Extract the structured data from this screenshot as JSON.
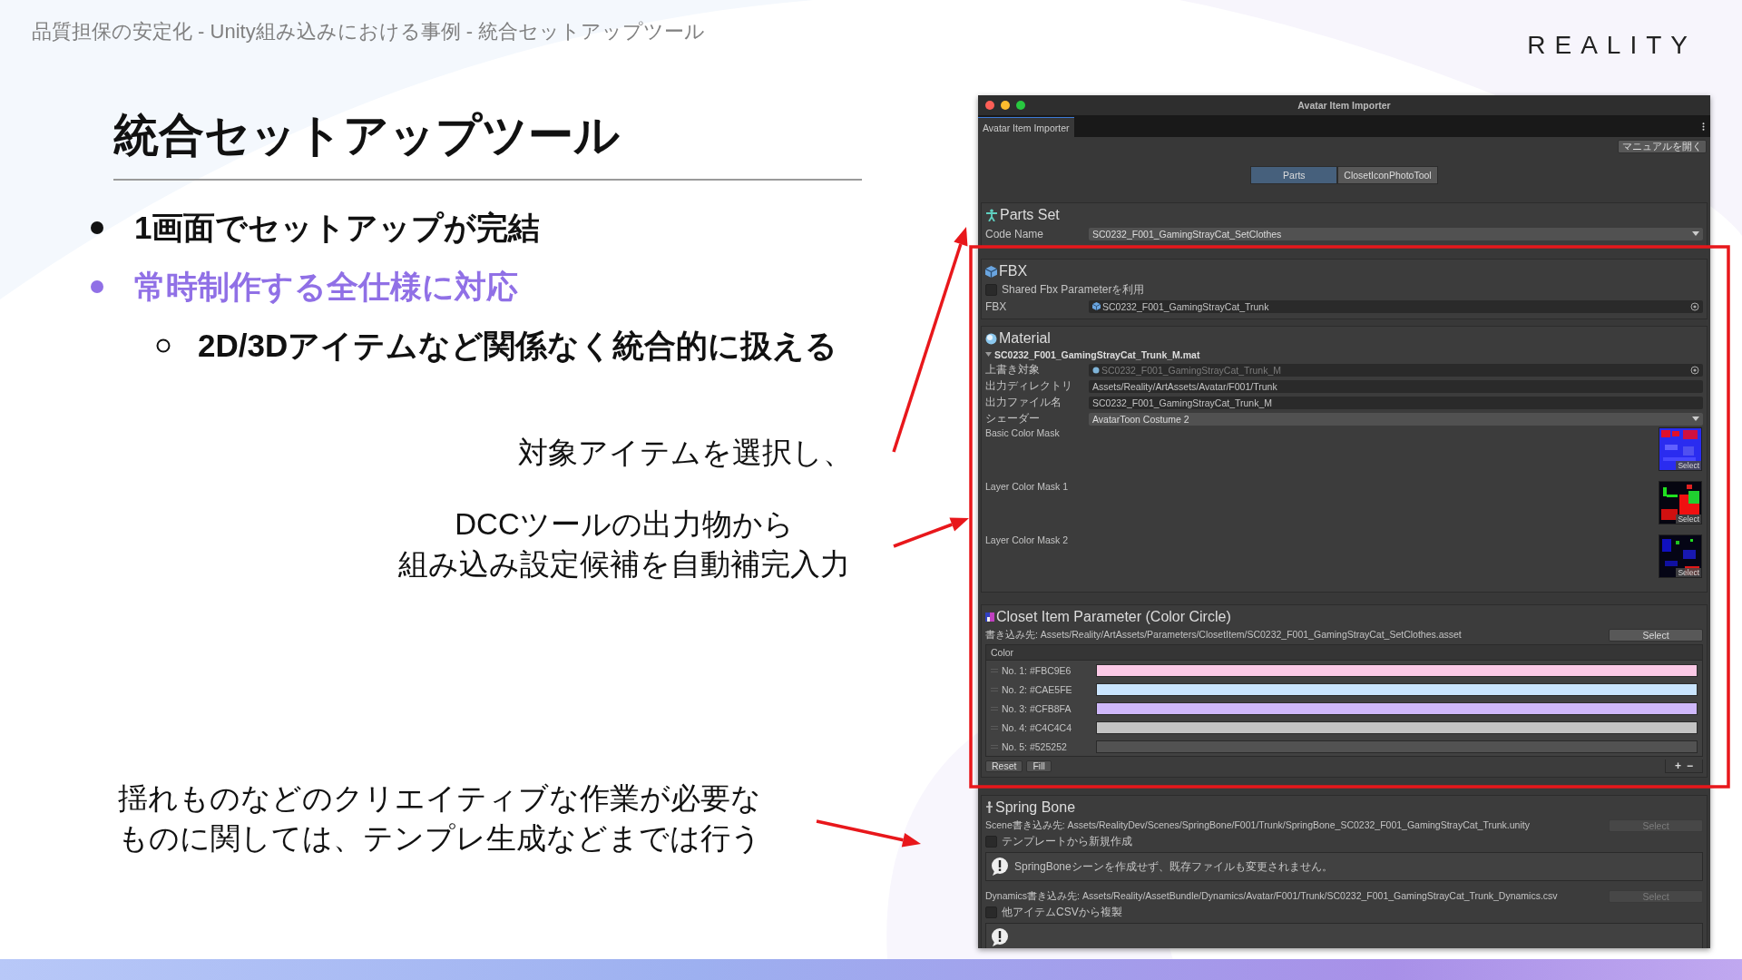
{
  "slide": {
    "breadcrumb": "品質担保の安定化 - Unity組み込みにおける事例 - 統合セットアップツール",
    "logo": "REALITY",
    "title": "統合セットアップツール",
    "bullets": [
      {
        "text": "1画面でセットアップが完結",
        "highlighted": false
      },
      {
        "text": "常時制作する全仕様に対応",
        "highlighted": true,
        "children": [
          {
            "text": "2D/3Dアイテムなど関係なく統合的に扱える"
          }
        ]
      }
    ],
    "callouts": [
      {
        "text": "対象アイテムを選択し、"
      },
      {
        "lines": [
          "DCCツールの出力物から",
          "組み込み設定候補を自動補完入力"
        ]
      },
      {
        "lines": [
          "揺れものなどのクリエイティブな作業が必要な",
          "ものに関しては、テンプレ生成などまでは行う"
        ]
      }
    ]
  },
  "window": {
    "title": "Avatar Item Importer",
    "tab": "Avatar Item Importer",
    "manual_button": "マニュアルを開く",
    "mode_tabs": [
      {
        "label": "Parts",
        "selected": true
      },
      {
        "label": "ClosetIconPhotoTool",
        "selected": false
      }
    ],
    "parts_set": {
      "title": "Parts Set",
      "label": "Code Name",
      "value": "SC0232_F001_GamingStrayCat_SetClothes"
    },
    "fbx": {
      "title": "FBX",
      "shared": {
        "label": "Shared Fbx Parameterを利用",
        "checked": false
      },
      "label": "FBX",
      "value": "SC0232_F001_GamingStrayCat_Trunk"
    },
    "material": {
      "title": "Material",
      "asset": "SC0232_F001_GamingStrayCat_Trunk_M.mat",
      "expanded": true,
      "fields": [
        {
          "kind": "object",
          "label": "上書き対象",
          "value": "SC0232_F001_GamingStrayCat_Trunk_M",
          "disabled": true
        },
        {
          "kind": "text",
          "label": "出力ディレクトリ",
          "value": "Assets/Reality/ArtAssets/Avatar/F001/Trunk",
          "disabled": false
        },
        {
          "kind": "text",
          "label": "出力ファイル名",
          "value": "SC0232_F001_GamingStrayCat_Trunk_M",
          "disabled": false
        },
        {
          "kind": "dropdown",
          "label": "シェーダー",
          "value": "AvatarToon Costume 2",
          "disabled": false
        }
      ],
      "masks": [
        {
          "label": "Basic Color Mask",
          "button": "Select"
        },
        {
          "label": "Layer Color Mask 1",
          "button": "Select"
        },
        {
          "label": "Layer Color Mask 2",
          "button": "Select"
        }
      ]
    },
    "closet": {
      "title": "Closet Item Parameter (Color Circle)",
      "path": "書き込み先: Assets/Reality/ArtAssets/Parameters/ClosetItem/SC0232_F001_GamingStrayCat_SetClothes.asset",
      "select": "Select",
      "list_header": "Color",
      "colors": [
        {
          "label": "No. 1: #FBC9E6",
          "color": "#fbc9e6"
        },
        {
          "label": "No. 2: #CAE5FE",
          "color": "#cae5fe"
        },
        {
          "label": "No. 3: #CFB8FA",
          "color": "#cfb8fa"
        },
        {
          "label": "No. 4: #C4C4C4",
          "color": "#c4c4c4"
        },
        {
          "label": "No. 5: #525252",
          "color": "#525252"
        }
      ],
      "reset": "Reset",
      "fill": "Fill",
      "add": "+",
      "remove": "−"
    },
    "spring_bone": {
      "title": "Spring Bone",
      "scene_path": "Scene書き込み先: Assets/RealityDev/Scenes/SpringBone/F001/Trunk/SpringBone_SC0232_F001_GamingStrayCat_Trunk.unity",
      "scene_select": {
        "label": "Select",
        "disabled": true
      },
      "template": {
        "label": "テンプレートから新規作成",
        "checked": false
      },
      "scene_note": "SpringBoneシーンを作成せず、既存ファイルも変更されません。",
      "dynamics_path": "Dynamics書き込み先: Assets/Reality/AssetBundle/Dynamics/Avatar/F001/Trunk/SC0232_F001_GamingStrayCat_Trunk_Dynamics.csv",
      "dynamics_select": {
        "label": "Select",
        "disabled": true
      },
      "copy": {
        "label": "他アイテムCSVから複製",
        "checked": false
      }
    }
  }
}
